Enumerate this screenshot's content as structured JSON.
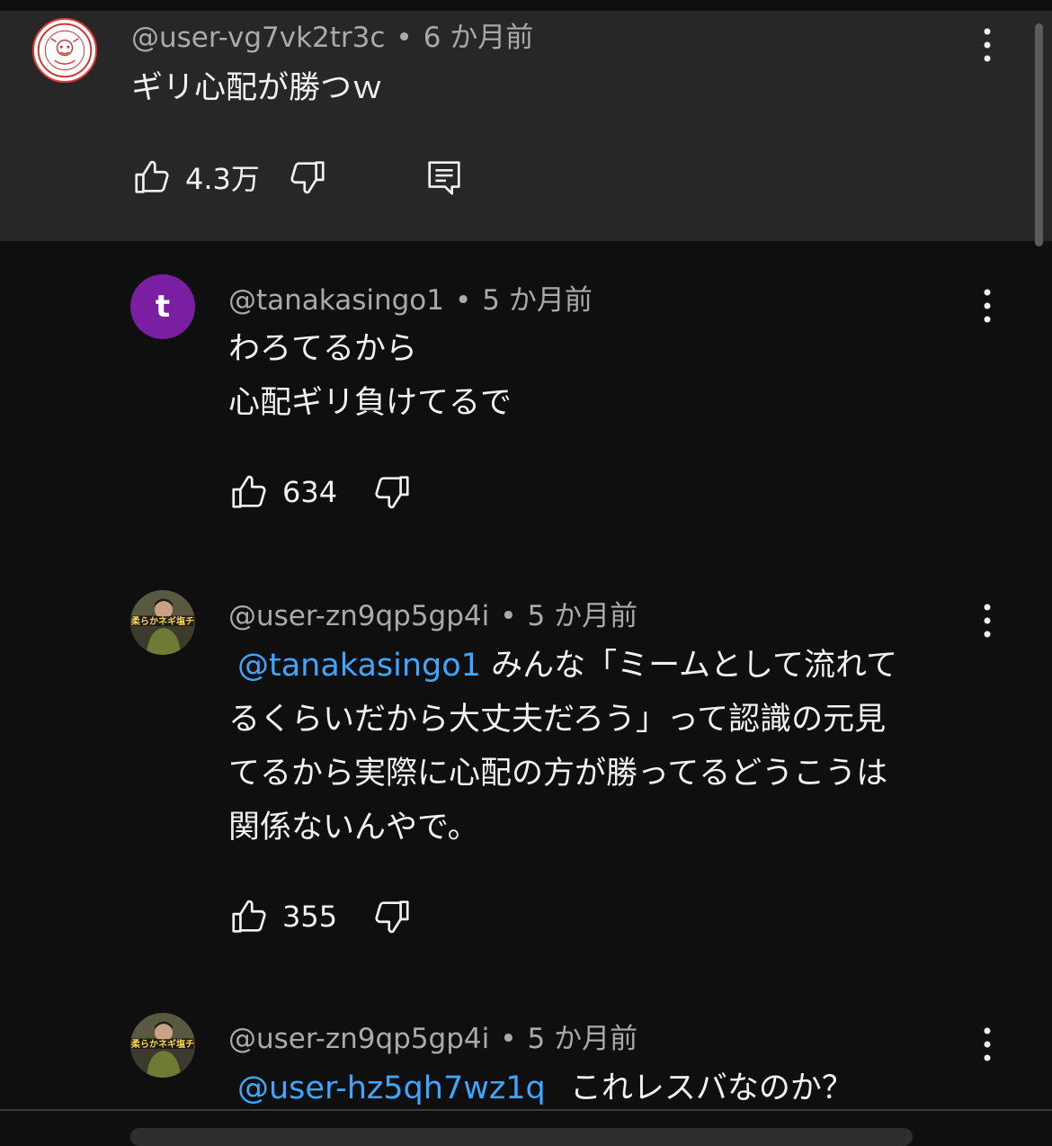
{
  "colors": {
    "background": "#0f0f0f",
    "highlight_background": "#272727",
    "meta_text": "#aaaaaa",
    "mention": "#3ea6ff",
    "avatar_purple": "#7b1fa2"
  },
  "parent_comment": {
    "author": "@user-vg7vk2tr3c",
    "time": "6 か月前",
    "text": "ギリ心配が勝つｗ",
    "likes": "4.3万",
    "icons": [
      "thumbs-up-icon",
      "thumbs-down-icon",
      "reply-comment-icon",
      "more-vert-icon"
    ]
  },
  "replies": [
    {
      "author": "@tanakasingo1",
      "time": "5 か月前",
      "avatar_letter": "t",
      "lines": [
        "わろてるから",
        "心配ギリ負けてるで"
      ],
      "likes": "634"
    },
    {
      "author": "@user-zn9qp5gp4i",
      "time": "5 か月前",
      "avatar_caption": "柔らかネギ塩チ",
      "mention": "@tanakasingo1",
      "lines": [
        "みんな「ミームとして流れて",
        "るくらいだから大丈夫だろう」って認識の元見",
        "てるから実際に心配の方が勝ってるどうこうは",
        "関係ないんやで。"
      ],
      "likes": "355"
    },
    {
      "author": "@user-zn9qp5gp4i",
      "time": "5 か月前",
      "avatar_caption": "柔らかネギ塩チ",
      "mention": "@user-hz5qh7wz1q",
      "text": "これレスバなのか？"
    }
  ],
  "separator": "•"
}
